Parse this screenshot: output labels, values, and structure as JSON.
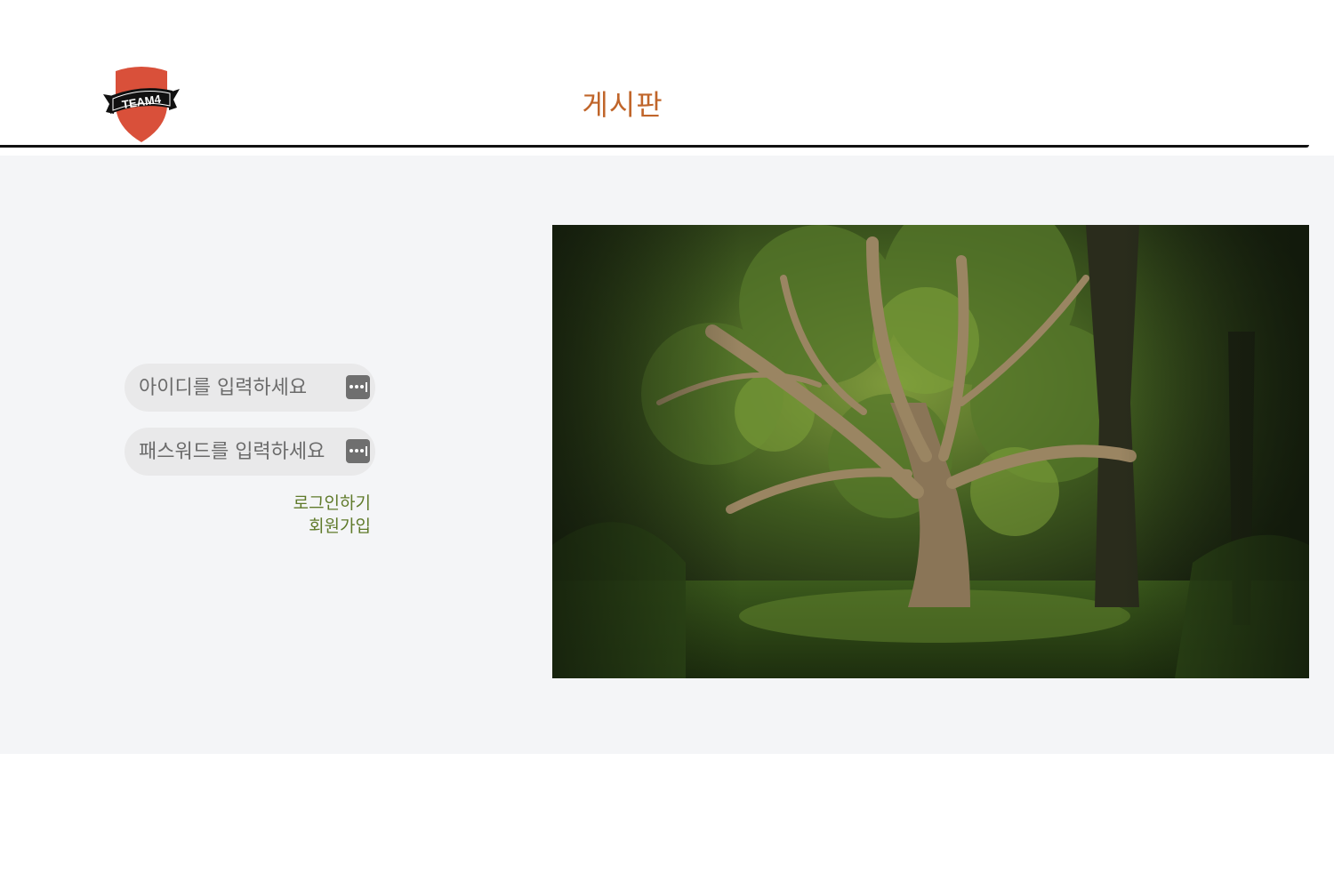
{
  "header": {
    "logo_text": "TEAM4",
    "title": "게시판"
  },
  "login": {
    "id_placeholder": "아이디를 입력하세요",
    "password_placeholder": "패스워드를 입력하세요",
    "login_link": "로그인하기",
    "signup_link": "회원가입"
  },
  "icons": {
    "logo": "shield-logo-icon",
    "password_manager": "password-manager-icon"
  },
  "colors": {
    "title": "#c0652a",
    "link": "#5f7a2a",
    "logo_shield": "#d9503a",
    "background": "#f4f5f7"
  },
  "hero_image": {
    "subject": "forest with large banyan tree"
  }
}
